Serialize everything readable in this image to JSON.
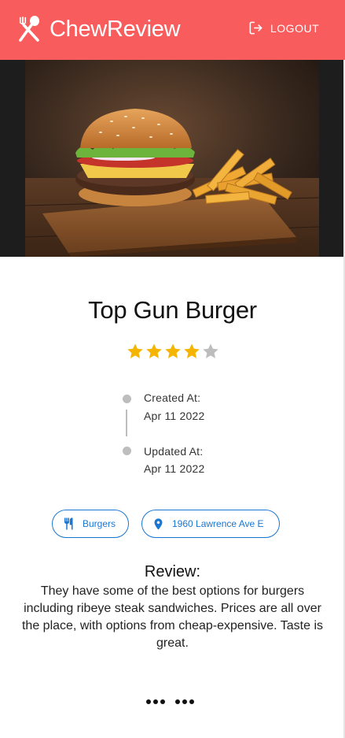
{
  "app": {
    "title": "ChewReview",
    "logout_label": "LOGOUT",
    "header_color": "#f85c5c"
  },
  "hero": {
    "image": "burger-with-fries-on-wooden-board"
  },
  "restaurant": {
    "name": "Top Gun Burger",
    "rating": 4,
    "rating_max": 5
  },
  "timeline": {
    "created_label": "Created At:",
    "created_date": "Apr 11 2022",
    "updated_label": "Updated At:",
    "updated_date": "Apr 11 2022"
  },
  "chips": {
    "category": {
      "label": "Burgers",
      "icon": "restaurant-icon"
    },
    "location": {
      "label": "1960 Lawrence Ave E",
      "icon": "location-pin-icon"
    }
  },
  "review": {
    "heading": "Review:",
    "body": "They have some of the best options for burgers including ribeye steak sandwiches. Prices are all over the place, with options from cheap-expensive. Taste is great."
  },
  "colors": {
    "accent": "#1976d2",
    "star_filled": "#f5b400",
    "star_empty": "#bdbdbd"
  }
}
